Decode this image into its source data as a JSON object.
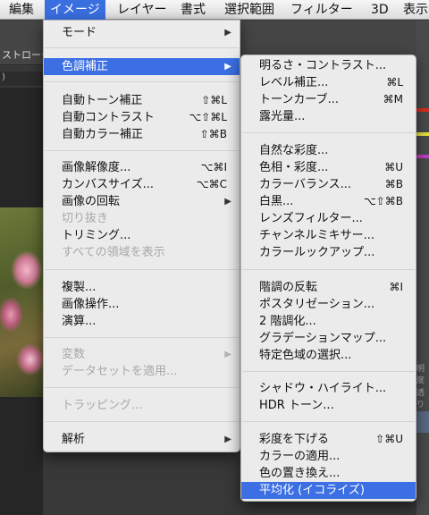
{
  "menubar": {
    "items": [
      "編集",
      "イメージ",
      "レイヤー",
      "書式",
      "選択範囲",
      "フィルター",
      "3D",
      "表示"
    ]
  },
  "options_bar": {
    "label": "ストローク"
  },
  "document_tab": {
    "label": ")"
  },
  "right_panel": {
    "label1": "明度",
    "label2": "透り"
  },
  "colors": {
    "highlight": "#3b6fe3",
    "menubar_active": "#3a6fe0",
    "swatches": [
      "#d83020",
      "#e8e040",
      "#c03cc0"
    ]
  },
  "image_menu": {
    "items": [
      {
        "label": "モード",
        "shortcut": "",
        "submenu": true,
        "disabled": false,
        "highlighted": false
      },
      {
        "label": "色調補正",
        "shortcut": "",
        "submenu": true,
        "disabled": false,
        "highlighted": true
      },
      {
        "label": "自動トーン補正",
        "shortcut": "⇧⌘L",
        "submenu": false,
        "disabled": false,
        "highlighted": false
      },
      {
        "label": "自動コントラスト",
        "shortcut": "⌥⇧⌘L",
        "submenu": false,
        "disabled": false,
        "highlighted": false
      },
      {
        "label": "自動カラー補正",
        "shortcut": "⇧⌘B",
        "submenu": false,
        "disabled": false,
        "highlighted": false
      },
      {
        "label": "画像解像度...",
        "shortcut": "⌥⌘I",
        "submenu": false,
        "disabled": false,
        "highlighted": false
      },
      {
        "label": "カンバスサイズ...",
        "shortcut": "⌥⌘C",
        "submenu": false,
        "disabled": false,
        "highlighted": false
      },
      {
        "label": "画像の回転",
        "shortcut": "",
        "submenu": true,
        "disabled": false,
        "highlighted": false
      },
      {
        "label": "切り抜き",
        "shortcut": "",
        "submenu": false,
        "disabled": true,
        "highlighted": false
      },
      {
        "label": "トリミング...",
        "shortcut": "",
        "submenu": false,
        "disabled": false,
        "highlighted": false
      },
      {
        "label": "すべての領域を表示",
        "shortcut": "",
        "submenu": false,
        "disabled": true,
        "highlighted": false
      },
      {
        "label": "複製...",
        "shortcut": "",
        "submenu": false,
        "disabled": false,
        "highlighted": false
      },
      {
        "label": "画像操作...",
        "shortcut": "",
        "submenu": false,
        "disabled": false,
        "highlighted": false
      },
      {
        "label": "演算...",
        "shortcut": "",
        "submenu": false,
        "disabled": false,
        "highlighted": false
      },
      {
        "label": "変数",
        "shortcut": "",
        "submenu": true,
        "disabled": true,
        "highlighted": false
      },
      {
        "label": "データセットを適用...",
        "shortcut": "",
        "submenu": false,
        "disabled": true,
        "highlighted": false
      },
      {
        "label": "トラッピング...",
        "shortcut": "",
        "submenu": false,
        "disabled": true,
        "highlighted": false
      },
      {
        "label": "解析",
        "shortcut": "",
        "submenu": true,
        "disabled": false,
        "highlighted": false
      }
    ]
  },
  "adjustments_menu": {
    "items": [
      {
        "label": "明るさ・コントラスト...",
        "shortcut": "",
        "highlighted": false
      },
      {
        "label": "レベル補正...",
        "shortcut": "⌘L",
        "highlighted": false
      },
      {
        "label": "トーンカーブ...",
        "shortcut": "⌘M",
        "highlighted": false
      },
      {
        "label": "露光量...",
        "shortcut": "",
        "highlighted": false
      },
      {
        "label": "自然な彩度...",
        "shortcut": "",
        "highlighted": false
      },
      {
        "label": "色相・彩度...",
        "shortcut": "⌘U",
        "highlighted": false
      },
      {
        "label": "カラーバランス...",
        "shortcut": "⌘B",
        "highlighted": false
      },
      {
        "label": "白黒...",
        "shortcut": "⌥⇧⌘B",
        "highlighted": false
      },
      {
        "label": "レンズフィルター...",
        "shortcut": "",
        "highlighted": false
      },
      {
        "label": "チャンネルミキサー...",
        "shortcut": "",
        "highlighted": false
      },
      {
        "label": "カラールックアップ...",
        "shortcut": "",
        "highlighted": false
      },
      {
        "label": "階調の反転",
        "shortcut": "⌘I",
        "highlighted": false
      },
      {
        "label": "ポスタリゼーション...",
        "shortcut": "",
        "highlighted": false
      },
      {
        "label": "2 階調化...",
        "shortcut": "",
        "highlighted": false
      },
      {
        "label": "グラデーションマップ...",
        "shortcut": "",
        "highlighted": false
      },
      {
        "label": "特定色域の選択...",
        "shortcut": "",
        "highlighted": false
      },
      {
        "label": "シャドウ・ハイライト...",
        "shortcut": "",
        "highlighted": false
      },
      {
        "label": "HDR トーン...",
        "shortcut": "",
        "highlighted": false
      },
      {
        "label": "彩度を下げる",
        "shortcut": "⇧⌘U",
        "highlighted": false
      },
      {
        "label": "カラーの適用...",
        "shortcut": "",
        "highlighted": false
      },
      {
        "label": "色の置き換え...",
        "shortcut": "",
        "highlighted": false
      },
      {
        "label": "平均化 (イコライズ)",
        "shortcut": "",
        "highlighted": true
      }
    ]
  }
}
